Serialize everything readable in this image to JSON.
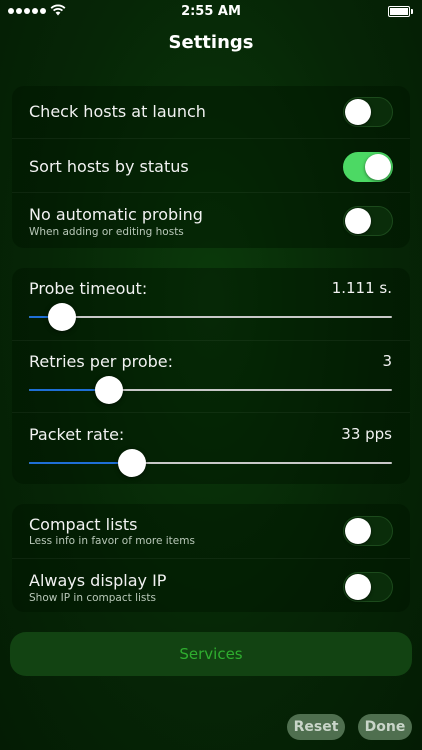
{
  "status_bar": {
    "time": "2:55 AM"
  },
  "nav": {
    "title": "Settings"
  },
  "group1": {
    "check_hosts": {
      "label": "Check hosts at launch",
      "on": false
    },
    "sort_hosts": {
      "label": "Sort hosts by status",
      "on": true
    },
    "no_probing": {
      "label": "No automatic probing",
      "sublabel": "When adding or editing hosts",
      "on": false
    }
  },
  "group2": {
    "probe_timeout": {
      "label": "Probe timeout:",
      "value": "1.111 s.",
      "fraction": 0.09
    },
    "retries": {
      "label": "Retries per probe:",
      "value": "3",
      "fraction": 0.22
    },
    "packet_rate": {
      "label": "Packet rate:",
      "value": "33 pps",
      "fraction": 0.285
    }
  },
  "group3": {
    "compact_lists": {
      "label": "Compact lists",
      "sublabel": "Less info in favor of more items",
      "on": false
    },
    "always_ip": {
      "label": "Always display IP",
      "sublabel": "Show IP in compact lists",
      "on": false
    }
  },
  "buttons": {
    "services": "Services",
    "reset": "Reset",
    "done": "Done"
  },
  "colors": {
    "accent_green": "#4cd964",
    "slider_fill": "#1f6fd6",
    "services_text": "#2fae2f"
  }
}
